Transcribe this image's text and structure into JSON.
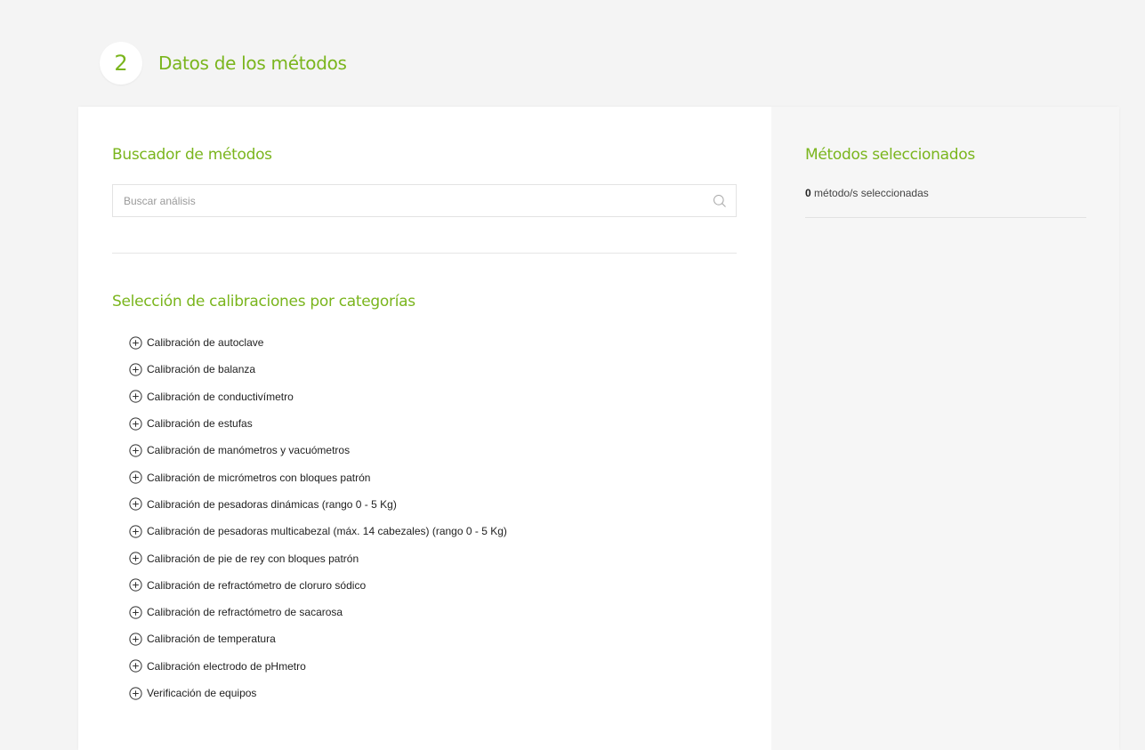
{
  "step": {
    "number": "2",
    "title": "Datos de los métodos"
  },
  "search_section": {
    "title": "Buscador de métodos",
    "placeholder": "Buscar análisis",
    "icon": "search-icon"
  },
  "categories_section": {
    "title": "Selección de calibraciones por categorías",
    "icon": "plus-circle-icon",
    "items": [
      "Calibración de autoclave",
      "Calibración de balanza",
      "Calibración de conductivímetro",
      "Calibración de estufas",
      "Calibración de manómetros y vacuómetros",
      "Calibración de micrómetros con bloques patrón",
      "Calibración de pesadoras dinámicas (rango 0 - 5 Kg)",
      "Calibración de pesadoras multicabezal (máx. 14 cabezales) (rango 0 - 5 Kg)",
      "Calibración de pie de rey con bloques patrón",
      "Calibración de refractómetro de cloruro sódico",
      "Calibración de refractómetro de sacarosa",
      "Calibración de temperatura",
      "Calibración electrodo de pHmetro",
      "Verificación de equipos"
    ]
  },
  "selected_section": {
    "title": "Métodos seleccionados",
    "count": "0",
    "count_label": " método/s seleccionadas"
  },
  "colors": {
    "accent": "#7ab51d",
    "background": "#f4f4f4",
    "panel": "#f6f6f6"
  }
}
